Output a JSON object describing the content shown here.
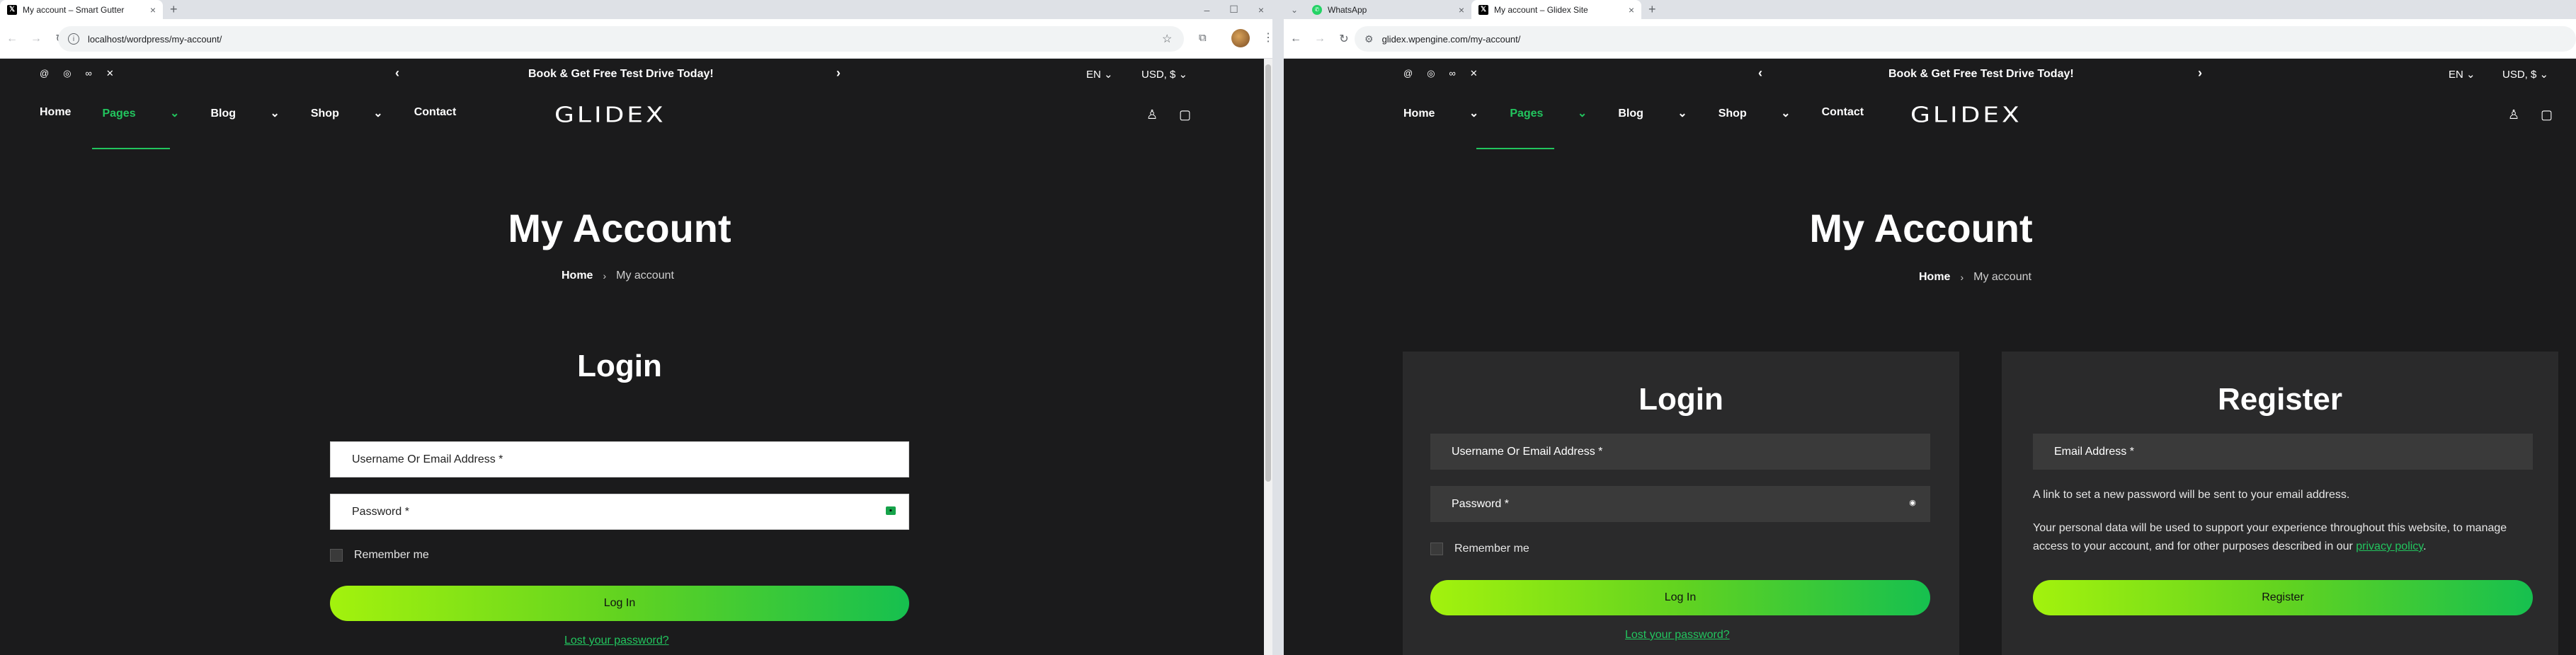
{
  "left": {
    "tab": {
      "title": "My account – Smart Gutter",
      "close": "×"
    },
    "new_tab": "+",
    "window_controls": [
      "–",
      "☐",
      "×"
    ],
    "url": "localhost/wordpress/my-account/",
    "site": {
      "promo": "Book & Get Free Test Drive Today!",
      "lang": "EN",
      "currency": "USD, $",
      "nav": [
        "Home",
        "Pages",
        "Blog",
        "Shop",
        "Contact"
      ],
      "logo": "GLIDEX",
      "title": "My Account",
      "breadcrumb": {
        "home": "Home",
        "current": "My account"
      },
      "login_heading": "Login",
      "username_placeholder": "Username Or Email Address *",
      "password_placeholder": "Password *",
      "remember": "Remember me",
      "login_button": "Log In",
      "lost_password": "Lost your password?"
    }
  },
  "right": {
    "tabs": [
      {
        "title": "WhatsApp",
        "close": "×"
      },
      {
        "title": "My account – Glidex Site",
        "close": "×"
      }
    ],
    "new_tab": "+",
    "url": "glidex.wpengine.com/my-account/",
    "site": {
      "promo": "Book & Get Free Test Drive Today!",
      "lang": "EN",
      "currency": "USD, $",
      "nav": [
        "Home",
        "Pages",
        "Blog",
        "Shop",
        "Contact"
      ],
      "logo": "GLIDEX",
      "title": "My Account",
      "breadcrumb": {
        "home": "Home",
        "current": "My account"
      },
      "login_heading": "Login",
      "username_placeholder": "Username Or Email Address *",
      "password_placeholder": "Password *",
      "remember": "Remember me",
      "login_button": "Log In",
      "lost_password": "Lost your password?",
      "register_heading": "Register",
      "email_placeholder": "Email Address *",
      "register_note": "A link to set a new password will be sent to your email address.",
      "privacy_text": "Your personal data will be used to support your experience throughout this website, to manage access to your account, and for other purposes described in our",
      "privacy_link": "privacy policy",
      "register_button": "Register"
    }
  },
  "icons": {
    "social": [
      "threads-icon",
      "instagram-icon",
      "meta-icon",
      "x-icon"
    ],
    "header": [
      "user-icon",
      "cart-icon"
    ],
    "accent_color": "#22c55e"
  }
}
